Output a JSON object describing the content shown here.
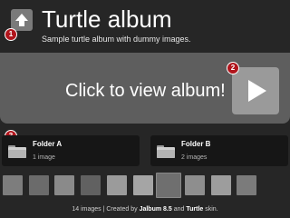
{
  "header": {
    "title": "Turtle album",
    "subtitle": "Sample turtle album with dummy images.",
    "up_icon": "up-arrow-icon"
  },
  "hero": {
    "label": "Click to view album!",
    "play_icon": "play-icon"
  },
  "badges": [
    "1",
    "2",
    "3"
  ],
  "folders": [
    {
      "name": "Folder A",
      "count": "1 image",
      "icon": "folder-icon"
    },
    {
      "name": "Folder B",
      "count": "2 images",
      "icon": "folder-icon"
    }
  ],
  "thumbnails": [
    {
      "color": "#7d7d7d"
    },
    {
      "color": "#6b6b6b"
    },
    {
      "color": "#8a8a8a"
    },
    {
      "color": "#616161"
    },
    {
      "color": "#9b9b9b"
    },
    {
      "color": "#a5a5a5"
    },
    {
      "color": "#6f6f6f",
      "selected": true
    },
    {
      "color": "#8e8e8e"
    },
    {
      "color": "#9d9d9d"
    },
    {
      "color": "#7b7b7b"
    }
  ],
  "footer": {
    "count": "14 images",
    "separator": "|",
    "created_by": "Created by",
    "app": "Jalbum 8.5",
    "and": "and",
    "skin": "Turtle",
    "skin_suffix": "skin."
  },
  "colors": {
    "background": "#262626",
    "hero": "#5e5e5e",
    "badge": "#b0151c",
    "folder_bg": "#161616"
  }
}
